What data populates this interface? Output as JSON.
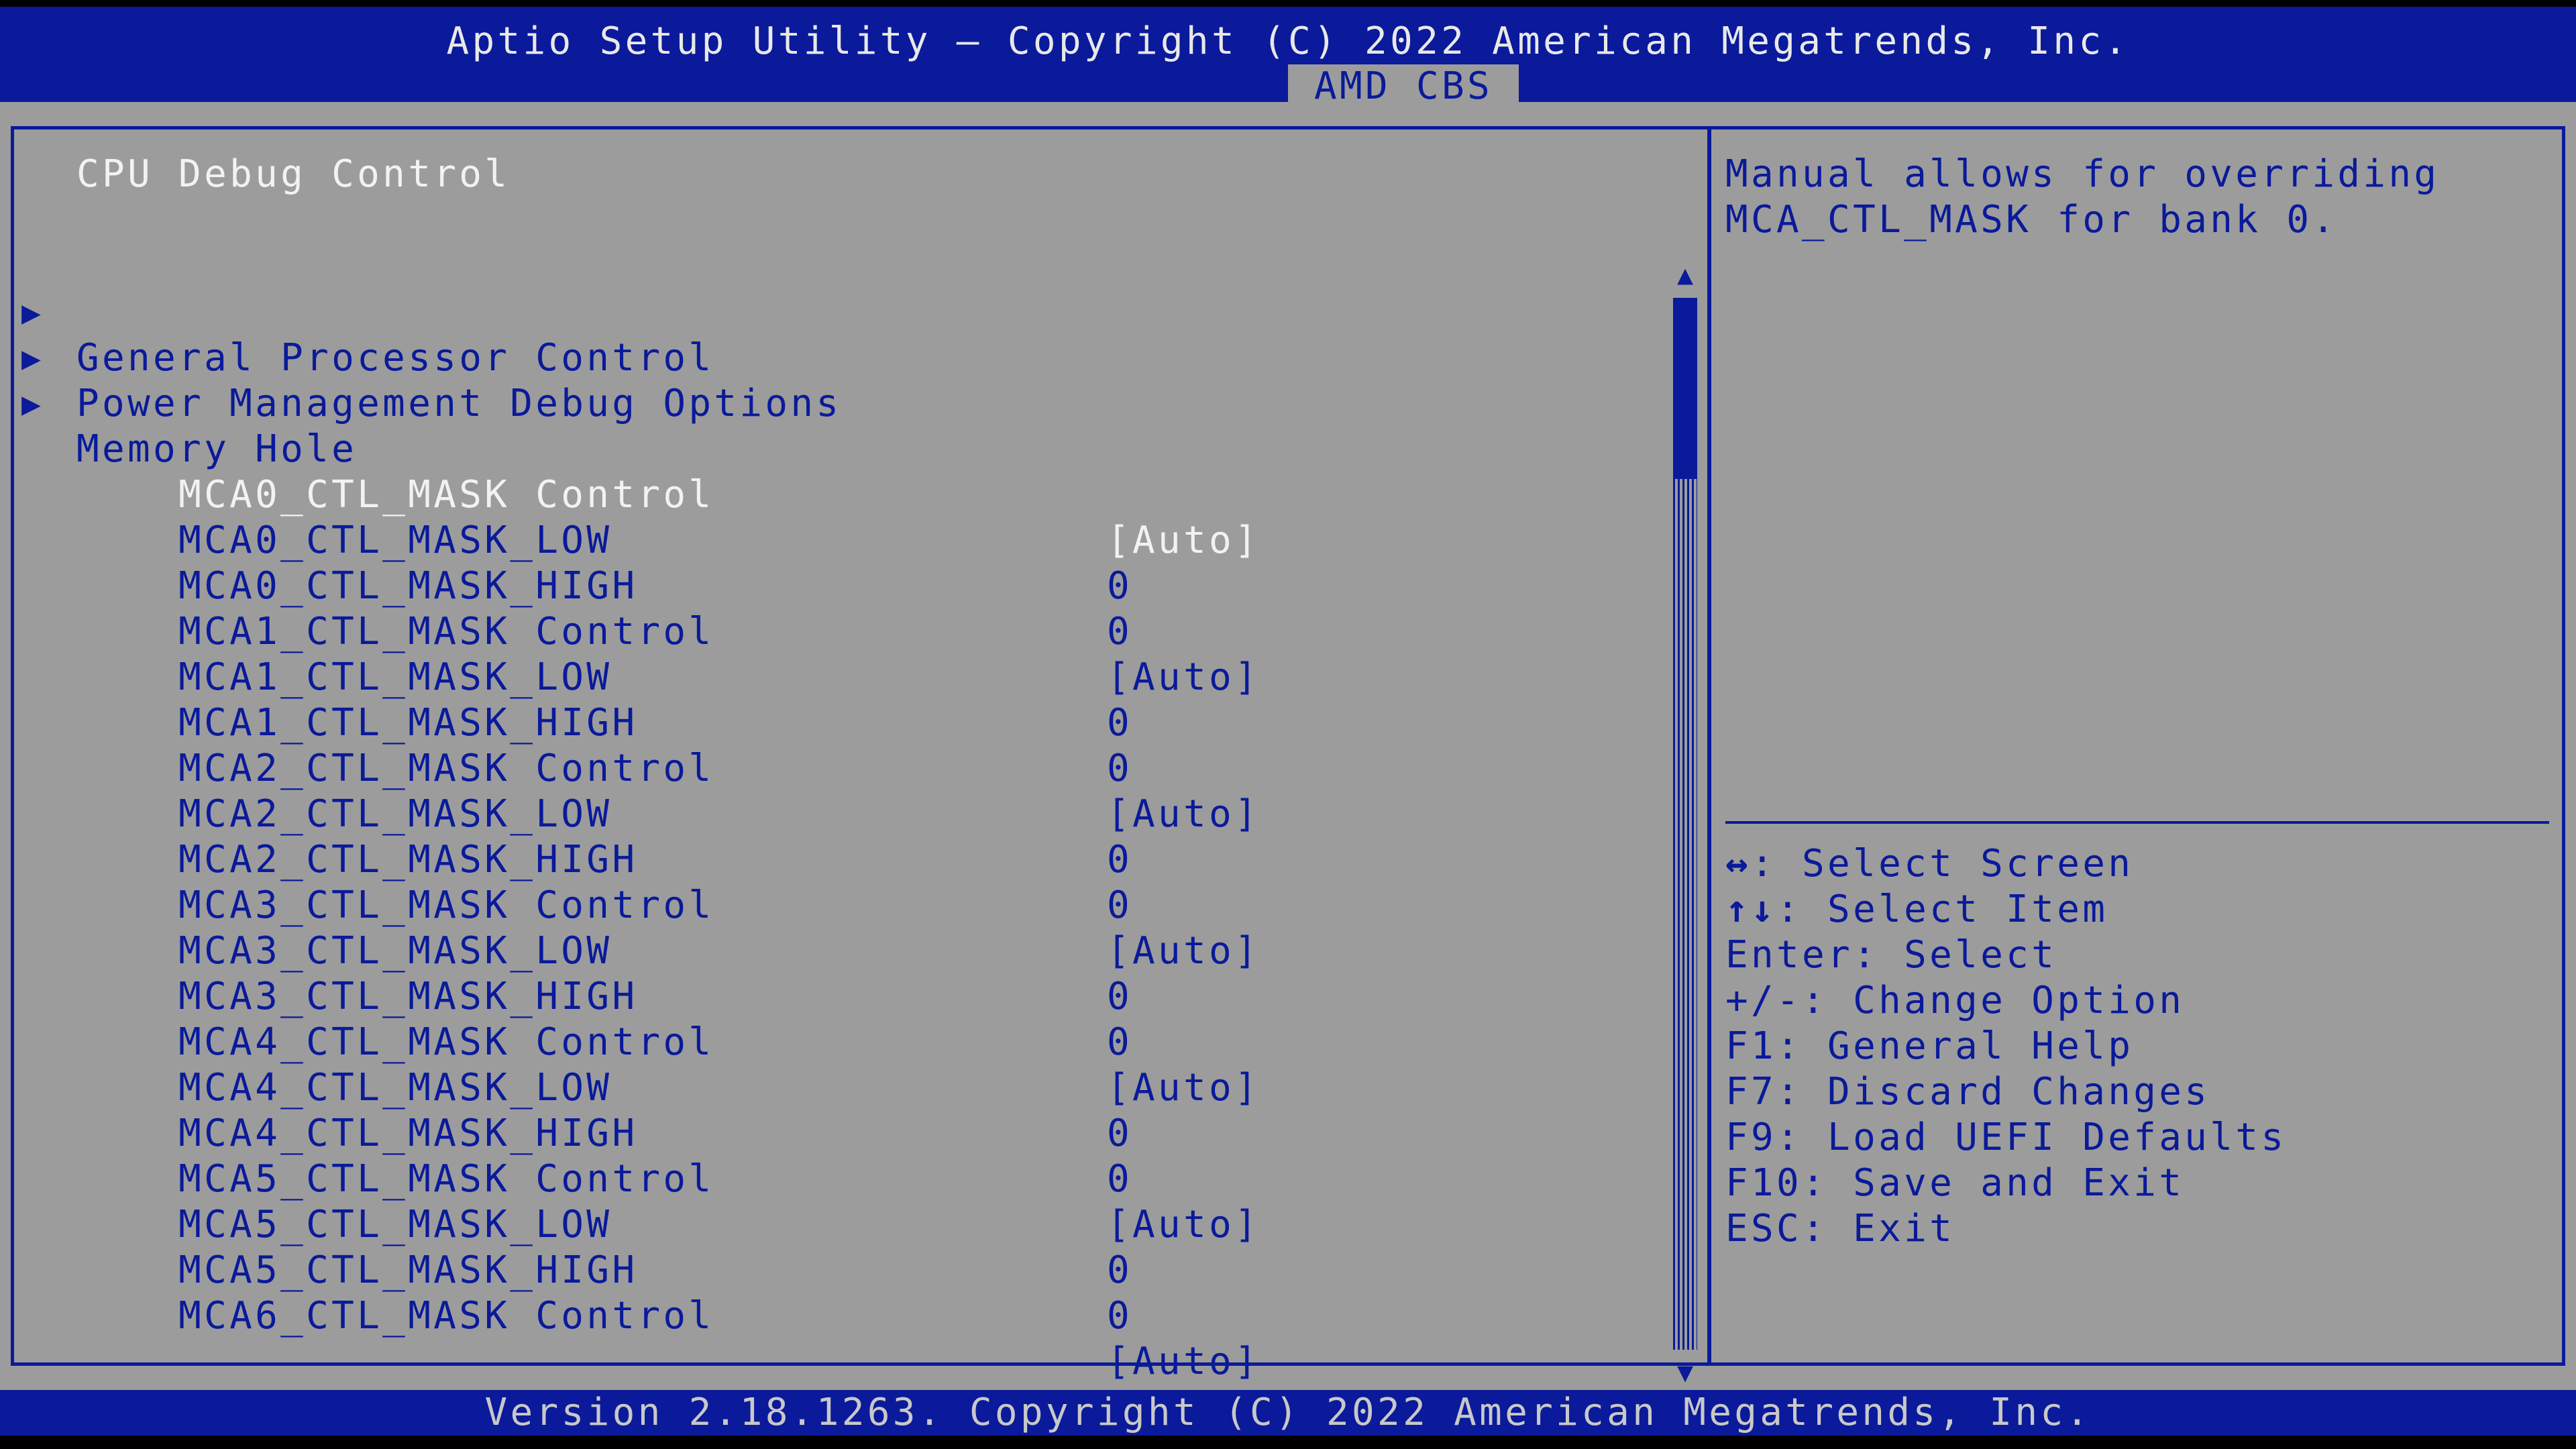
{
  "header": {
    "title": "Aptio Setup Utility – Copyright (C) 2022 American Megatrends, Inc.",
    "tab": "AMD CBS"
  },
  "page": {
    "section_title": "CPU Debug Control"
  },
  "submenus": [
    {
      "label": "General Processor Control"
    },
    {
      "label": "Power Management Debug Options"
    },
    {
      "label": "Memory Hole"
    }
  ],
  "settings": [
    {
      "label": "MCA0_CTL_MASK Control",
      "value": "[Auto]"
    },
    {
      "label": "MCA0_CTL_MASK_LOW",
      "value": "0"
    },
    {
      "label": "MCA0_CTL_MASK_HIGH",
      "value": "0"
    },
    {
      "label": "MCA1_CTL_MASK Control",
      "value": "[Auto]"
    },
    {
      "label": "MCA1_CTL_MASK_LOW",
      "value": "0"
    },
    {
      "label": "MCA1_CTL_MASK_HIGH",
      "value": "0"
    },
    {
      "label": "MCA2_CTL_MASK Control",
      "value": "[Auto]"
    },
    {
      "label": "MCA2_CTL_MASK_LOW",
      "value": "0"
    },
    {
      "label": "MCA2_CTL_MASK_HIGH",
      "value": "0"
    },
    {
      "label": "MCA3_CTL_MASK Control",
      "value": "[Auto]"
    },
    {
      "label": "MCA3_CTL_MASK_LOW",
      "value": "0"
    },
    {
      "label": "MCA3_CTL_MASK_HIGH",
      "value": "0"
    },
    {
      "label": "MCA4_CTL_MASK Control",
      "value": "[Auto]"
    },
    {
      "label": "MCA4_CTL_MASK_LOW",
      "value": "0"
    },
    {
      "label": "MCA4_CTL_MASK_HIGH",
      "value": "0"
    },
    {
      "label": "MCA5_CTL_MASK Control",
      "value": "[Auto]"
    },
    {
      "label": "MCA5_CTL_MASK_LOW",
      "value": "0"
    },
    {
      "label": "MCA5_CTL_MASK_HIGH",
      "value": "0"
    },
    {
      "label": "MCA6_CTL_MASK Control",
      "value": "[Auto]"
    }
  ],
  "help": {
    "lines": [
      "Manual allows for overriding",
      "MCA_CTL_MASK for bank 0."
    ]
  },
  "keys": [
    {
      "key": "↔",
      "text": ": Select Screen"
    },
    {
      "key": "↑↓",
      "text": ": Select Item"
    },
    {
      "key": "Enter",
      "text": ": Select"
    },
    {
      "key": "+/-",
      "text": ": Change Option"
    },
    {
      "key": "F1",
      "text": ": General Help"
    },
    {
      "key": "F7",
      "text": ": Discard Changes"
    },
    {
      "key": "F9",
      "text": ": Load UEFI Defaults"
    },
    {
      "key": "F10",
      "text": ": Save and Exit"
    },
    {
      "key": "ESC",
      "text": ": Exit"
    }
  ],
  "footer": {
    "text": "Version 2.18.1263. Copyright (C) 2022 American Megatrends, Inc."
  },
  "colors": {
    "header_blue": "#0a1a9a",
    "panel_gray": "#9c9c9c",
    "highlight_white": "#f2f2f2"
  }
}
